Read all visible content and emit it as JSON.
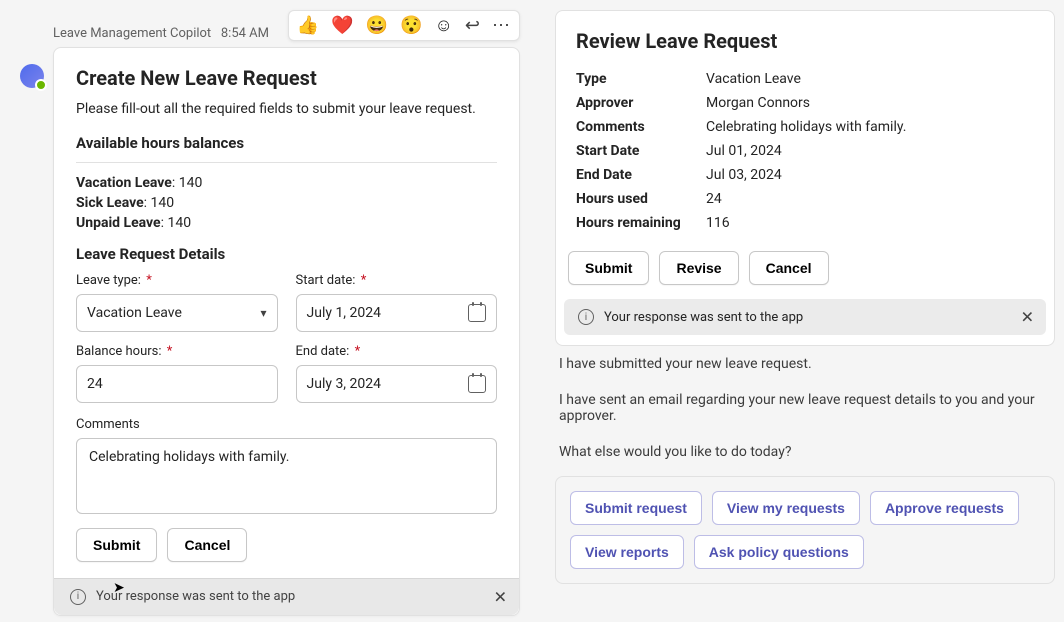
{
  "left": {
    "sender": "Leave Management Copilot",
    "time": "8:54 AM",
    "reactions": [
      "👍",
      "❤️",
      "😀",
      "😯"
    ],
    "card": {
      "title": "Create New Leave Request",
      "intro": "Please fill-out all the required fields to submit your leave request.",
      "balances_heading": "Available hours balances",
      "balances": [
        {
          "label": "Vacation Leave",
          "value": "140"
        },
        {
          "label": "Sick Leave",
          "value": "140"
        },
        {
          "label": "Unpaid Leave",
          "value": "140"
        }
      ],
      "details_heading": "Leave Request Details",
      "fields": {
        "leave_type_label": "Leave type:",
        "leave_type_value": "Vacation Leave",
        "start_date_label": "Start date:",
        "start_date_value": "July 1, 2024",
        "balance_hours_label": "Balance hours:",
        "balance_hours_value": "24",
        "end_date_label": "End date:",
        "end_date_value": "July 3, 2024",
        "comments_label": "Comments",
        "comments_value": "Celebrating holidays with family."
      },
      "submit_label": "Submit",
      "cancel_label": "Cancel",
      "notice": "Your response was sent to the app"
    }
  },
  "right": {
    "title": "Review Leave Request",
    "rows": {
      "type_k": "Type",
      "type_v": "Vacation Leave",
      "approver_k": "Approver",
      "approver_v": "Morgan Connors",
      "comments_k": "Comments",
      "comments_v": "Celebrating holidays with family.",
      "start_k": "Start Date",
      "start_v": "Jul 01, 2024",
      "end_k": "End Date",
      "end_v": "Jul 03, 2024",
      "used_k": "Hours used",
      "used_v": "24",
      "remain_k": "Hours remaining",
      "remain_v": "116"
    },
    "buttons": {
      "submit": "Submit",
      "revise": "Revise",
      "cancel": "Cancel"
    },
    "notice": "Your response was sent to the app",
    "messages": {
      "m1": "I have submitted your new leave request.",
      "m2": "I have sent an email regarding your new leave request details to you and your approver.",
      "m3": "What else would you like to do today?"
    },
    "suggestions": {
      "s1": "Submit request",
      "s2": "View my requests",
      "s3": "Approve requests",
      "s4": "View reports",
      "s5": "Ask policy questions"
    }
  }
}
